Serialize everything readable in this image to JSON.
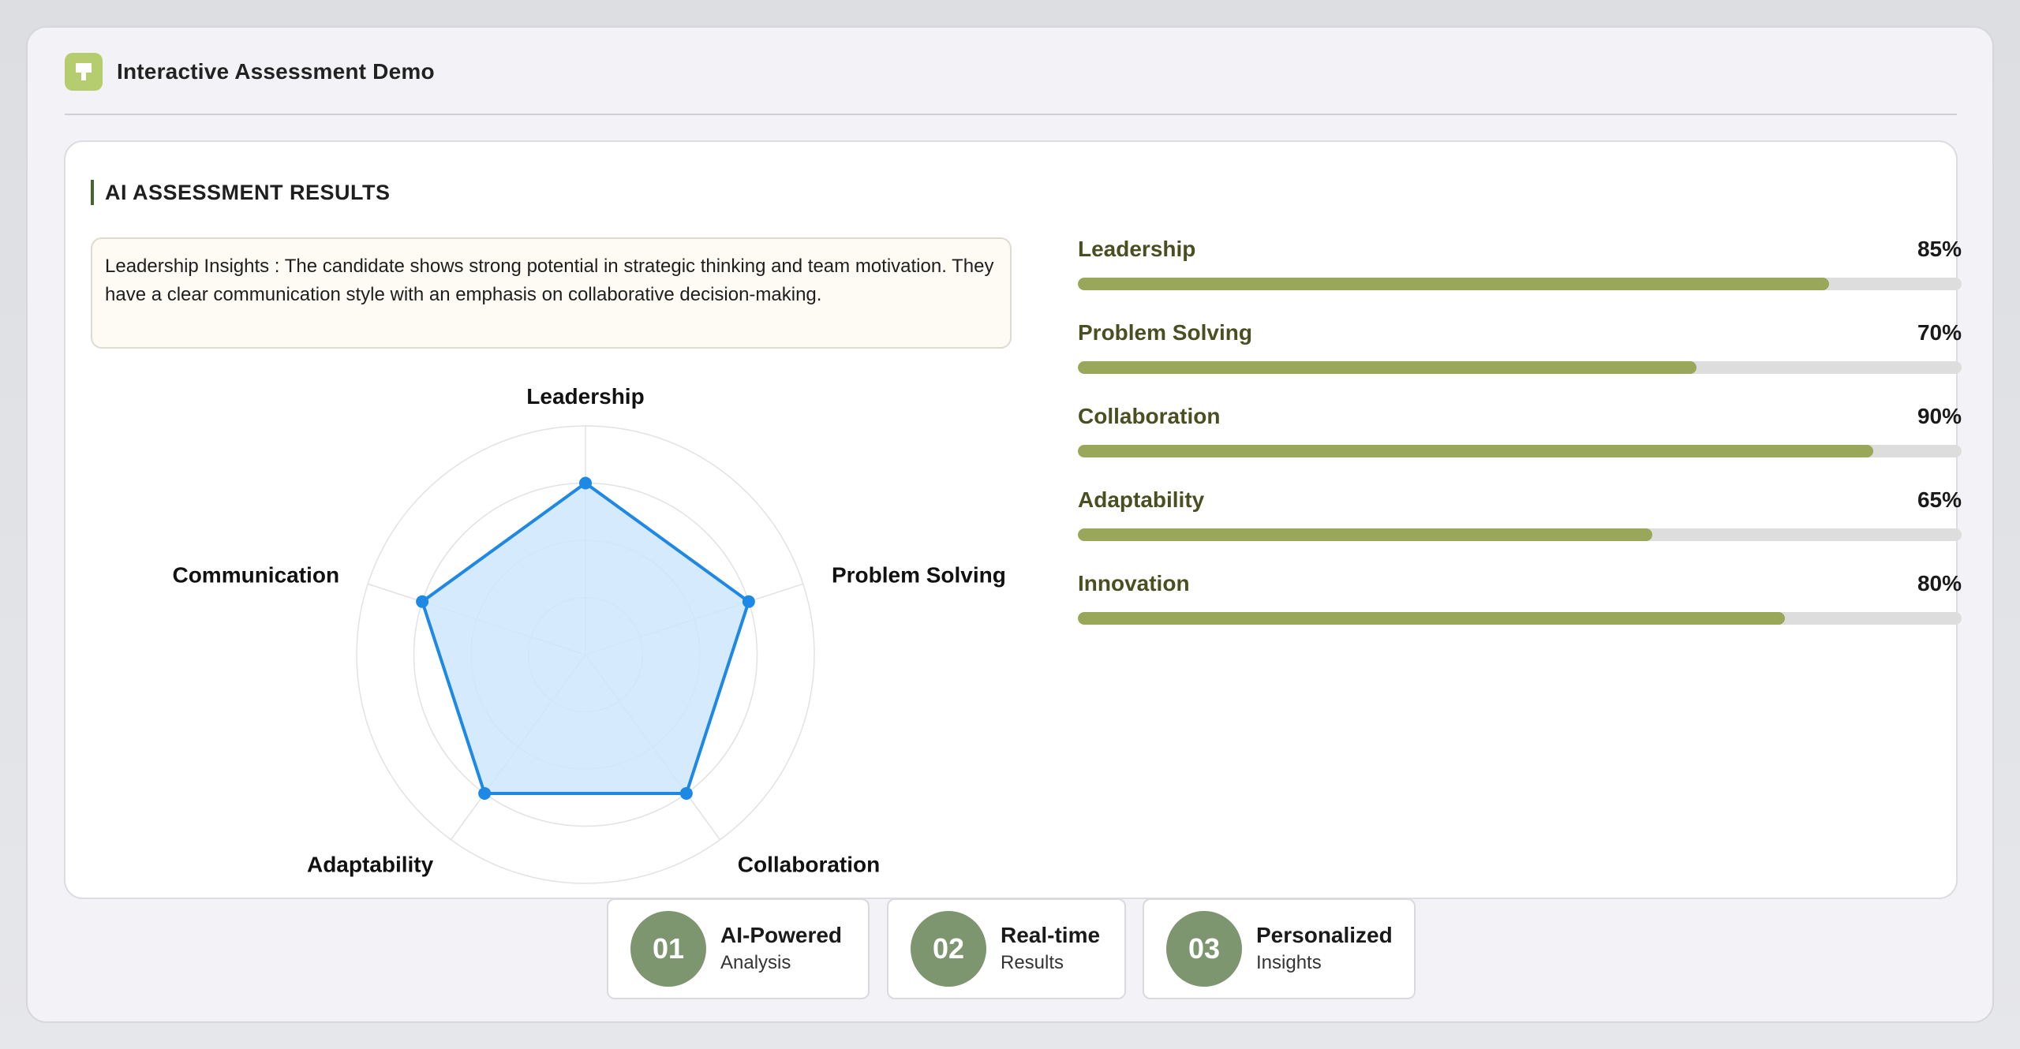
{
  "app": {
    "title": "Interactive Assessment Demo"
  },
  "results": {
    "section_title": "AI ASSESSMENT RESULTS",
    "insight": {
      "label": "Leadership Insights :",
      "text": "The candidate shows strong potential in strategic thinking and team motivation. They have a clear communication style with an emphasis on collaborative decision-making."
    }
  },
  "colors": {
    "accent_green": "#98a75a",
    "label_green": "#4a4f22",
    "radar_stroke": "#1e88e5",
    "radar_fill": "#cfe6fd",
    "badge_green": "#7d9670",
    "logo_green": "#b5cc6f"
  },
  "chart_data": {
    "type": "radar",
    "categories": [
      "Leadership",
      "Problem Solving",
      "Collaboration",
      "Adaptability",
      "Communication"
    ],
    "series": [
      {
        "values": [
          75,
          75,
          75,
          75,
          75
        ]
      }
    ],
    "rlim": [
      0,
      100
    ],
    "grid": true
  },
  "scores": [
    {
      "name": "Leadership",
      "value": 85,
      "display": "85%"
    },
    {
      "name": "Problem Solving",
      "value": 70,
      "display": "70%"
    },
    {
      "name": "Collaboration",
      "value": 90,
      "display": "90%"
    },
    {
      "name": "Adaptability",
      "value": 65,
      "display": "65%"
    },
    {
      "name": "Innovation",
      "value": 80,
      "display": "80%"
    }
  ],
  "features": [
    {
      "number": "01",
      "title": "AI-Powered",
      "subtitle": "Analysis"
    },
    {
      "number": "02",
      "title": "Real-time",
      "subtitle": "Results"
    },
    {
      "number": "03",
      "title": "Personalized",
      "subtitle": "Insights"
    }
  ]
}
